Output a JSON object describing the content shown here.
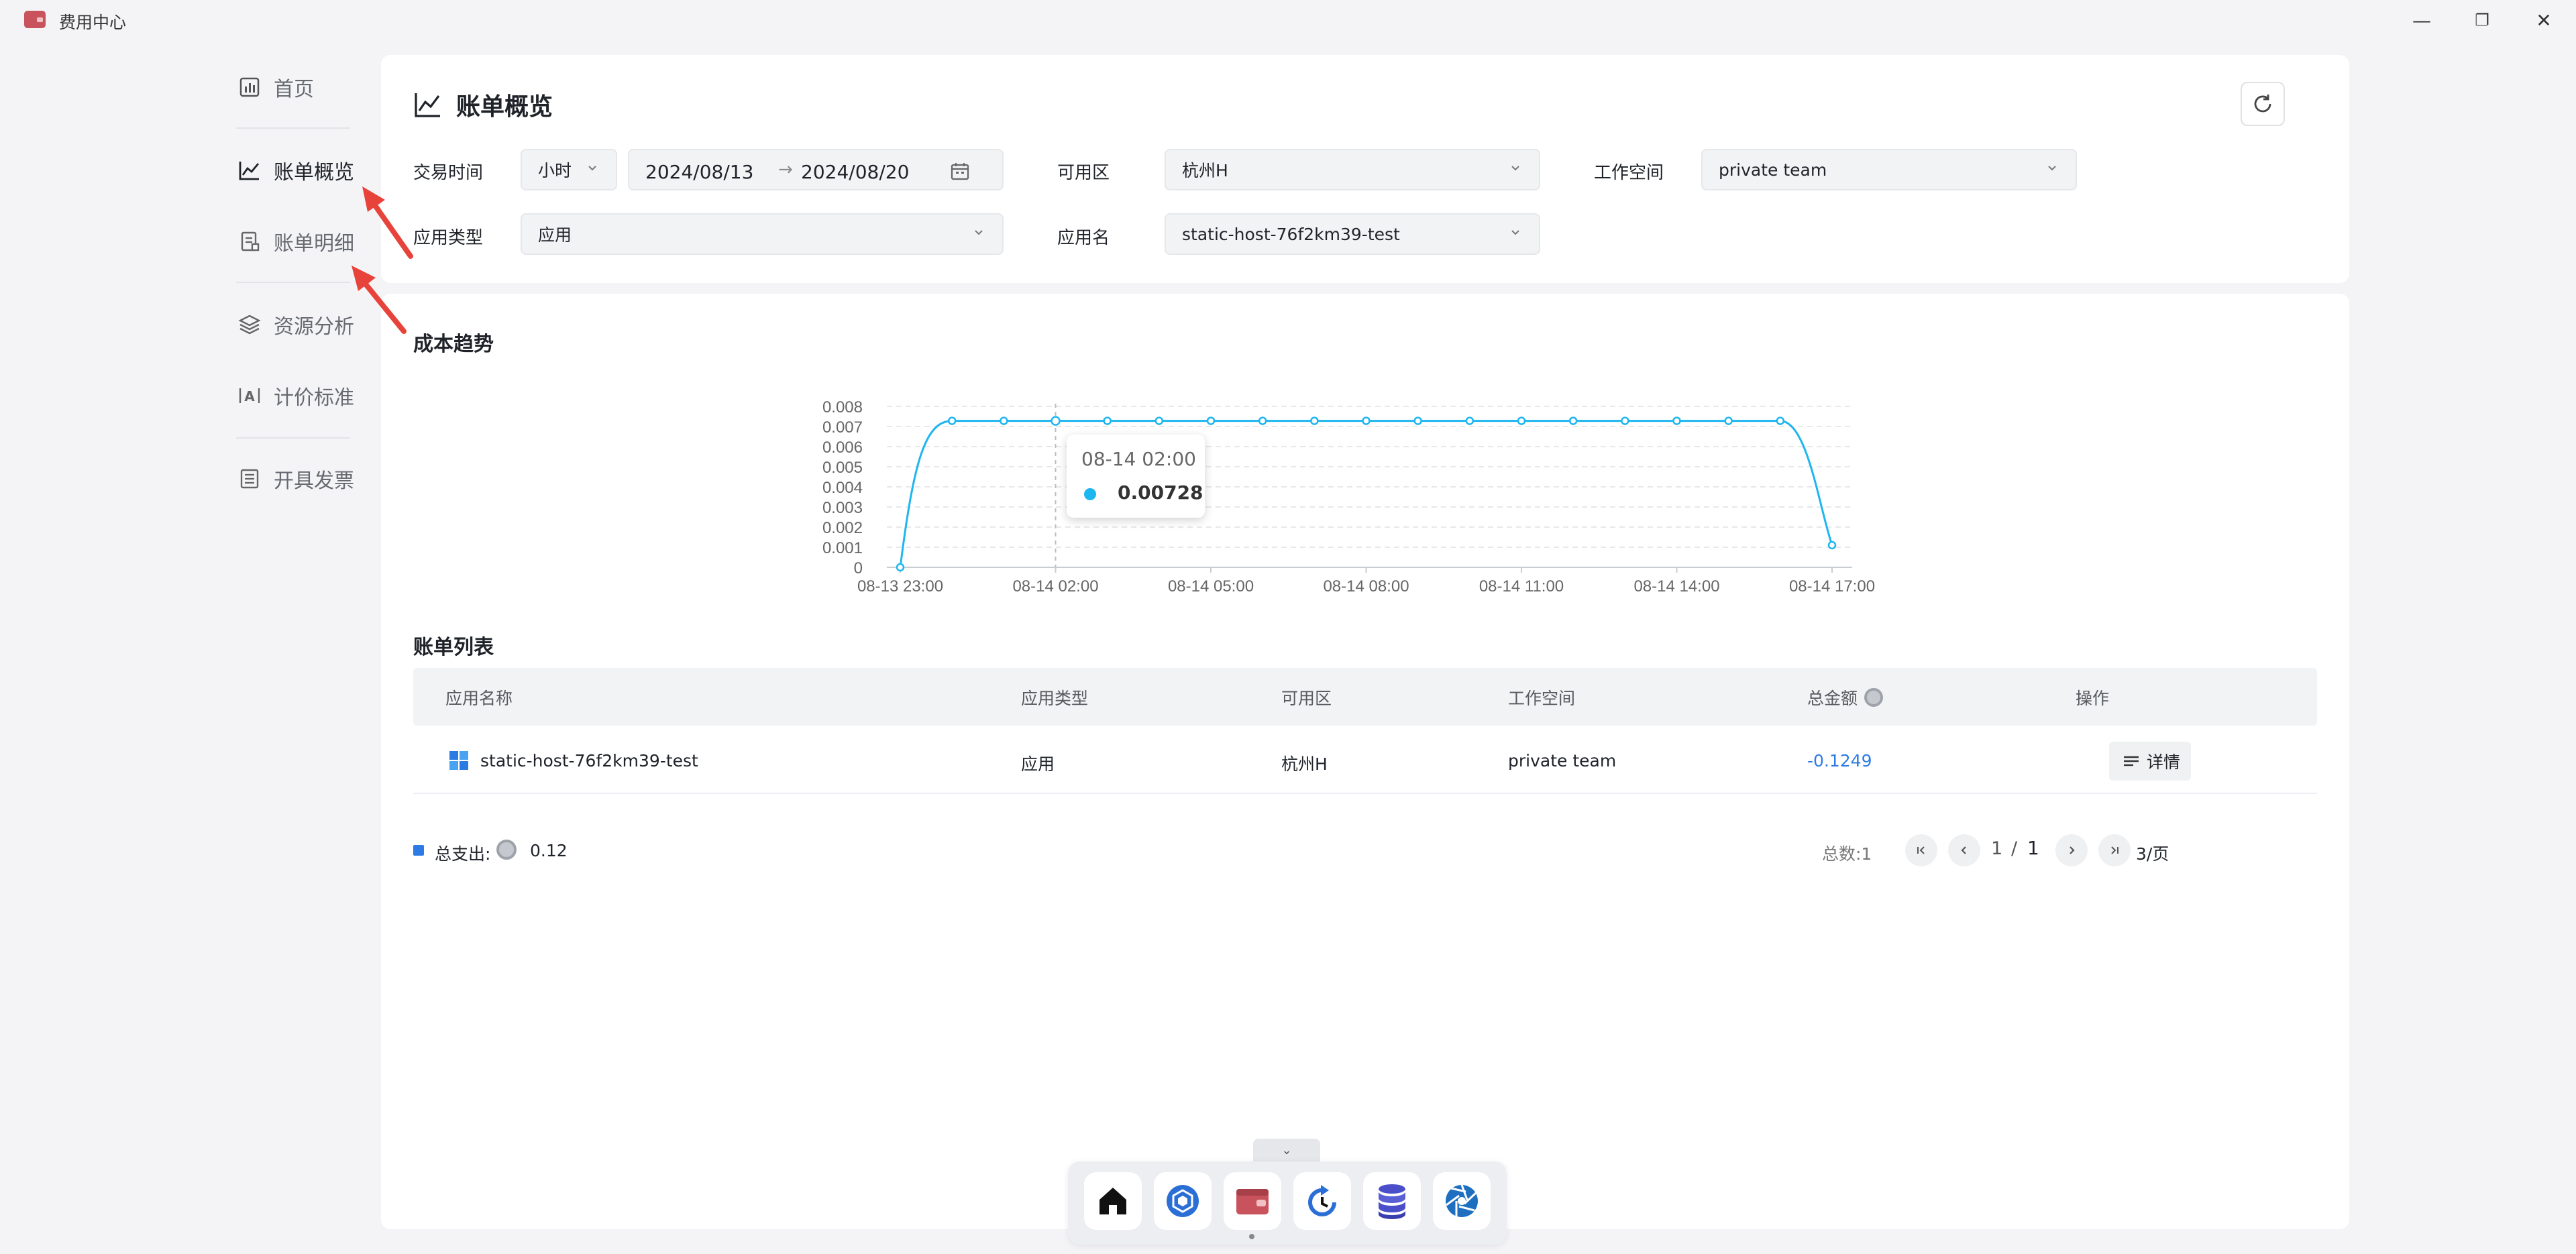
{
  "window": {
    "title": "费用中心",
    "minimize": "—",
    "restore": "❐",
    "close": "✕"
  },
  "sidebar": {
    "items": [
      {
        "label": "首页",
        "icon": "dashboard-icon"
      },
      {
        "label": "账单概览",
        "icon": "line-chart-icon"
      },
      {
        "label": "账单明细",
        "icon": "bill-detail-icon"
      },
      {
        "label": "资源分析",
        "icon": "layers-icon"
      },
      {
        "label": "计价标准",
        "icon": "pricing-icon"
      },
      {
        "label": "开具发票",
        "icon": "invoice-icon"
      }
    ],
    "active_index": 1
  },
  "filters": {
    "title": "账单概览",
    "trade_time_label": "交易时间",
    "granularity": "小时",
    "date_start": "2024/08/13",
    "date_sep": "→",
    "date_end": "2024/08/20",
    "zone_label": "可用区",
    "zone_value": "杭州H",
    "workspace_label": "工作空间",
    "workspace_value": "private team",
    "app_type_label": "应用类型",
    "app_type_value": "应用",
    "app_name_label": "应用名",
    "app_name_value": "static-host-76f2km39-test"
  },
  "trend": {
    "title": "成本趋势",
    "tooltip_time": "08-14 02:00",
    "tooltip_value": "0.00728"
  },
  "chart_data": {
    "type": "line",
    "title": "",
    "xlabel": "",
    "ylabel": "",
    "ylim": [
      0,
      0.008
    ],
    "y_ticks": [
      "0",
      "0.001",
      "0.002",
      "0.003",
      "0.004",
      "0.005",
      "0.006",
      "0.007",
      "0.008"
    ],
    "x_tick_labels": [
      "08-13 23:00",
      "08-14 02:00",
      "08-14 05:00",
      "08-14 08:00",
      "08-14 11:00",
      "08-14 14:00",
      "08-14 17:00"
    ],
    "x": [
      "08-13 23:00",
      "08-14 00:00",
      "08-14 01:00",
      "08-14 02:00",
      "08-14 03:00",
      "08-14 04:00",
      "08-14 05:00",
      "08-14 06:00",
      "08-14 07:00",
      "08-14 08:00",
      "08-14 09:00",
      "08-14 10:00",
      "08-14 11:00",
      "08-14 12:00",
      "08-14 13:00",
      "08-14 14:00",
      "08-14 15:00",
      "08-14 16:00",
      "08-14 17:00"
    ],
    "series": [
      {
        "values": [
          0,
          0.00728,
          0.00728,
          0.00728,
          0.00728,
          0.00728,
          0.00728,
          0.00728,
          0.00728,
          0.00728,
          0.00728,
          0.00728,
          0.00728,
          0.00728,
          0.00728,
          0.00728,
          0.00728,
          0.00728,
          0.0011
        ],
        "color": "#1eb6f0"
      }
    ],
    "grid": true,
    "legend": "none"
  },
  "bill_list": {
    "title": "账单列表",
    "columns": [
      "应用名称",
      "应用类型",
      "可用区",
      "工作空间",
      "总金额",
      "操作"
    ],
    "rows": [
      {
        "app_name": "static-host-76f2km39-test",
        "app_type": "应用",
        "zone": "杭州H",
        "workspace": "private team",
        "amount": "-0.1249",
        "action": "详情"
      }
    ],
    "amount_color": "#2c7be5"
  },
  "footer": {
    "total_label": "总支出:",
    "total_value": "0.12",
    "count_label": "总数:1",
    "page_current": "1",
    "page_sep": "/",
    "page_total": "1",
    "page_size": "3/页"
  },
  "dock": {
    "apps": [
      "home-icon",
      "cube-icon",
      "wallet-icon",
      "backup-icon",
      "database-icon",
      "aperture-icon"
    ],
    "toggle": "⌄"
  }
}
